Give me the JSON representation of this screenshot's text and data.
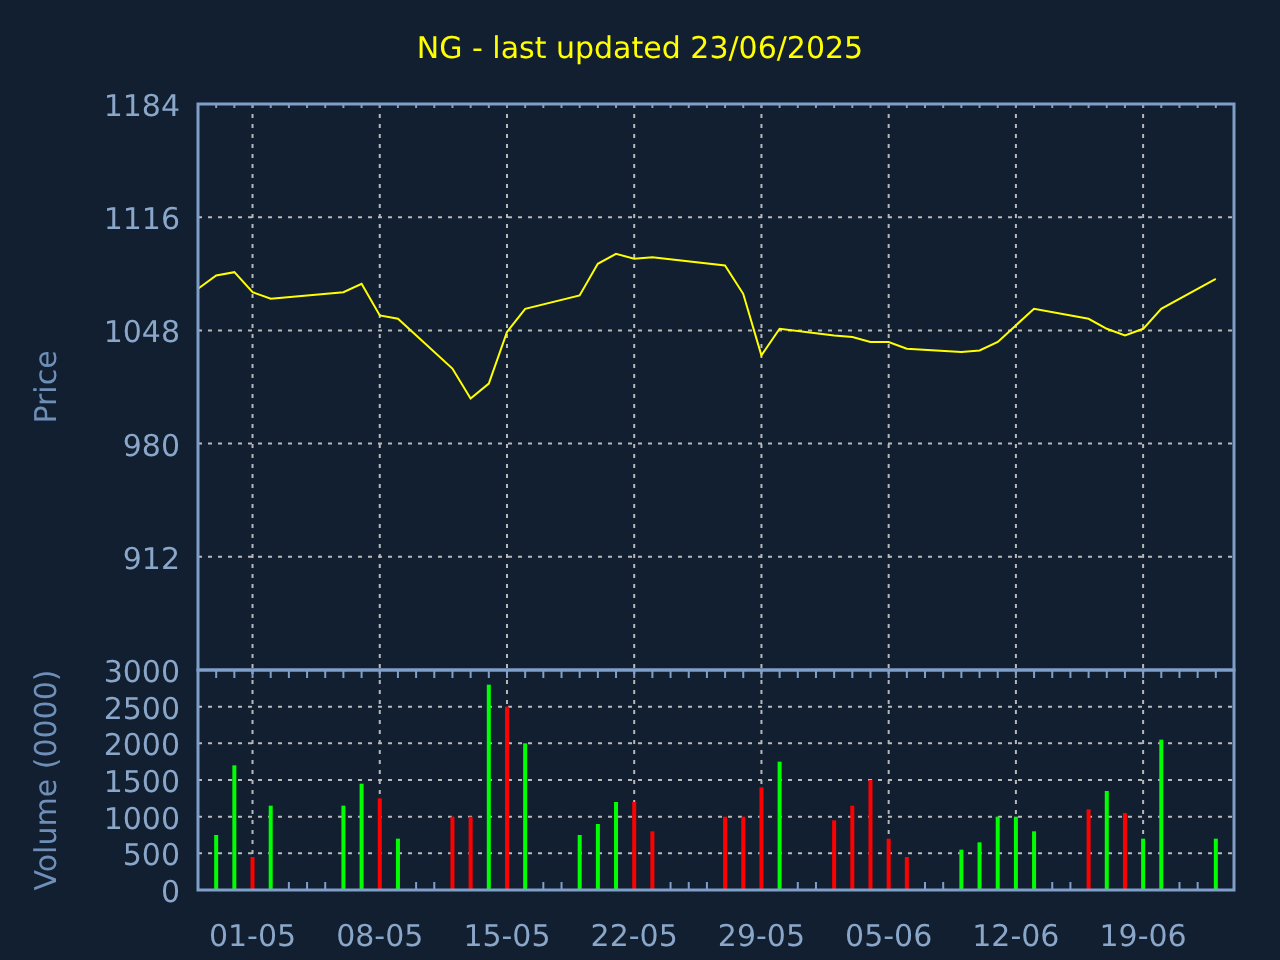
{
  "title": "NG - last updated 23/06/2025",
  "price_chart": {
    "chart_data": {
      "type": "line",
      "ylabel": "Price",
      "grid": true,
      "categories": [
        null,
        null,
        null,
        null,
        null,
        null,
        null,
        null,
        null,
        null,
        null,
        null,
        null,
        null,
        null,
        null,
        null,
        null,
        null,
        null,
        null,
        null,
        null,
        null,
        null,
        null,
        null,
        null,
        null,
        null,
        null,
        null,
        null,
        null,
        null,
        null,
        null,
        null,
        null,
        null,
        null,
        null,
        null,
        null,
        null,
        null,
        null,
        null,
        null,
        null,
        null,
        null,
        null,
        null,
        null,
        null,
        null
      ],
      "series": [
        {
          "color": "#ffff00",
          "values": [
            1073,
            1081,
            1083,
            1071,
            1067,
            null,
            null,
            null,
            1071,
            1076,
            1057,
            1055,
            null,
            null,
            1025,
            1007,
            1016,
            1047,
            1061,
            null,
            null,
            1069,
            1088,
            1094,
            1091,
            1092,
            null,
            null,
            null,
            1087,
            1070,
            1033,
            1049,
            null,
            null,
            1045,
            1044,
            1041,
            1041,
            1037,
            null,
            null,
            1035,
            1036,
            1041,
            1051,
            1061,
            null,
            null,
            1055,
            1049,
            1045,
            1049,
            1061,
            null,
            null,
            1079
          ]
        }
      ],
      "ylim": [
        844,
        1184
      ],
      "yticks": [
        1184,
        1116,
        1048,
        980,
        912
      ]
    }
  },
  "volume_chart": {
    "chart_data": {
      "type": "bar",
      "ylabel": "Volume (0000)",
      "grid": true,
      "categories": [
        null,
        null,
        null,
        "01-05",
        null,
        null,
        null,
        null,
        null,
        null,
        "08-05",
        null,
        null,
        null,
        null,
        null,
        null,
        "15-05",
        null,
        null,
        null,
        null,
        null,
        null,
        "22-05",
        null,
        null,
        null,
        null,
        null,
        null,
        "29-05",
        null,
        null,
        null,
        null,
        null,
        null,
        "05-06",
        null,
        null,
        null,
        null,
        null,
        null,
        "12-06",
        null,
        null,
        null,
        null,
        null,
        null,
        "19-06",
        null,
        null,
        null,
        null
      ],
      "series": [
        {
          "color": "#00ff00",
          "values": [
            null,
            750,
            1700,
            null,
            1150,
            null,
            null,
            null,
            1150,
            1450,
            null,
            700,
            null,
            null,
            null,
            null,
            2800,
            null,
            2000,
            null,
            null,
            750,
            900,
            1200,
            null,
            null,
            null,
            null,
            null,
            null,
            null,
            null,
            1750,
            null,
            null,
            null,
            null,
            null,
            null,
            null,
            null,
            null,
            550,
            650,
            1000,
            1000,
            800,
            null,
            null,
            null,
            1350,
            null,
            700,
            2050,
            null,
            null,
            700
          ]
        },
        {
          "color": "#ff0000",
          "values": [
            null,
            null,
            null,
            450,
            null,
            null,
            null,
            null,
            null,
            null,
            1250,
            null,
            null,
            null,
            1000,
            1000,
            null,
            2500,
            null,
            null,
            null,
            null,
            null,
            null,
            1200,
            800,
            null,
            null,
            null,
            1000,
            1000,
            1400,
            null,
            null,
            null,
            950,
            1150,
            1500,
            700,
            450,
            null,
            null,
            null,
            null,
            null,
            null,
            null,
            null,
            null,
            1100,
            null,
            1050,
            null,
            null,
            null,
            null,
            null
          ]
        }
      ],
      "ylim": [
        0,
        3000
      ],
      "yticks": [
        0,
        500,
        1000,
        1500,
        2000,
        2500,
        3000
      ]
    }
  }
}
